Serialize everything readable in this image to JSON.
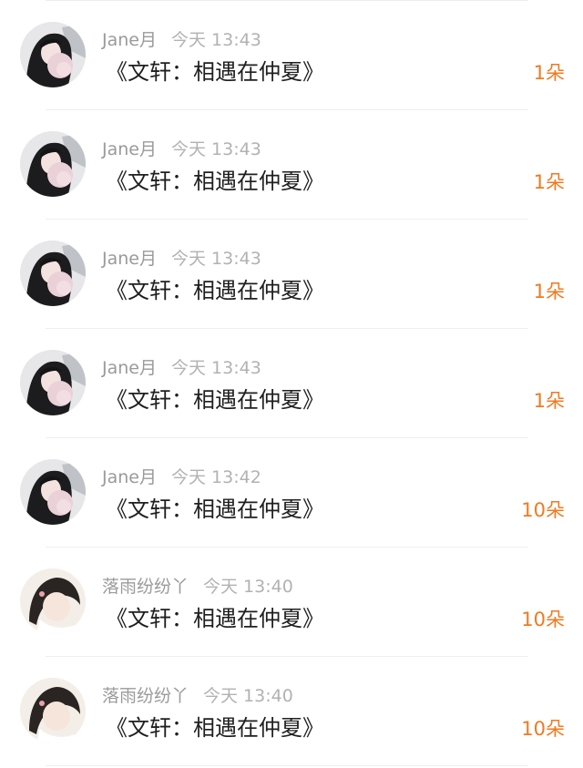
{
  "items": [
    {
      "user": "Jane月",
      "time": "今天 13:43",
      "message": "《文轩：相遇在仲夏》",
      "gift": "1朵",
      "avatar": "jane"
    },
    {
      "user": "Jane月",
      "time": "今天 13:43",
      "message": "《文轩：相遇在仲夏》",
      "gift": "1朵",
      "avatar": "jane"
    },
    {
      "user": "Jane月",
      "time": "今天 13:43",
      "message": "《文轩：相遇在仲夏》",
      "gift": "1朵",
      "avatar": "jane"
    },
    {
      "user": "Jane月",
      "time": "今天 13:43",
      "message": "《文轩：相遇在仲夏》",
      "gift": "1朵",
      "avatar": "jane"
    },
    {
      "user": "Jane月",
      "time": "今天 13:42",
      "message": "《文轩：相遇在仲夏》",
      "gift": "10朵",
      "avatar": "jane"
    },
    {
      "user": "落雨纷纷丫",
      "time": "今天 13:40",
      "message": "《文轩：相遇在仲夏》",
      "gift": "10朵",
      "avatar": "luoyu"
    },
    {
      "user": "落雨纷纷丫",
      "time": "今天 13:40",
      "message": "《文轩：相遇在仲夏》",
      "gift": "10朵",
      "avatar": "luoyu"
    }
  ],
  "colors": {
    "accent": "#f07a1f",
    "name_gray": "#9a9a9a",
    "text": "#1f1f1f"
  }
}
